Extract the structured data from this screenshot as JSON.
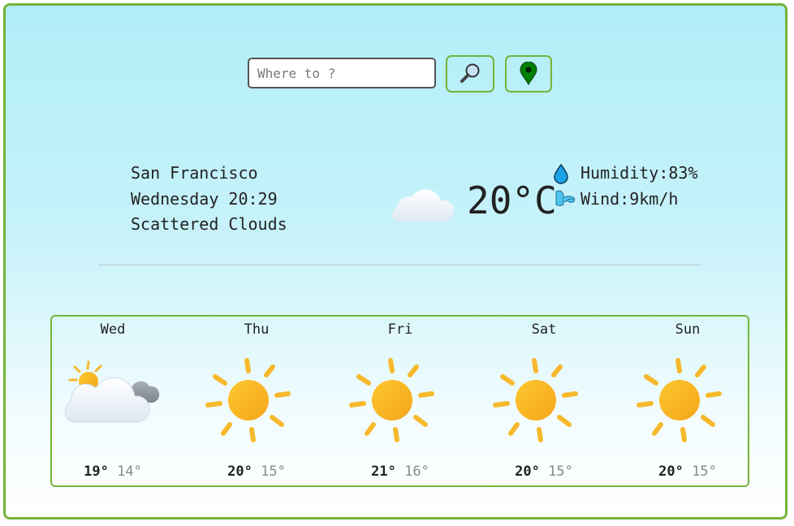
{
  "search": {
    "placeholder": "Where to ?",
    "value": ""
  },
  "buttons": {
    "search_icon": "magnifier-icon",
    "location_icon": "map-pin-icon"
  },
  "current": {
    "city": "San Francisco",
    "datetime": "Wednesday 20:29",
    "condition": "Scattered Clouds",
    "icon": "cloud-icon",
    "temperature": "20°C",
    "humidity": "Humidity:83%",
    "wind": "Wind:9km/h"
  },
  "forecast": [
    {
      "day": "Wed",
      "high": "19°",
      "low": "14°",
      "icon": "sun-behind-clouds-icon"
    },
    {
      "day": "Thu",
      "high": "20°",
      "low": "15°",
      "icon": "sun-icon"
    },
    {
      "day": "Fri",
      "high": "21°",
      "low": "16°",
      "icon": "sun-icon"
    },
    {
      "day": "Sat",
      "high": "20°",
      "low": "15°",
      "icon": "sun-icon"
    },
    {
      "day": "Sun",
      "high": "20°",
      "low": "15°",
      "icon": "sun-icon"
    }
  ],
  "colors": {
    "accent": "#74b43a",
    "sun": "#fbbf24",
    "sun_ray": "#f7b92b",
    "water_drop": "#1aa3e8",
    "pin": "#008000"
  }
}
